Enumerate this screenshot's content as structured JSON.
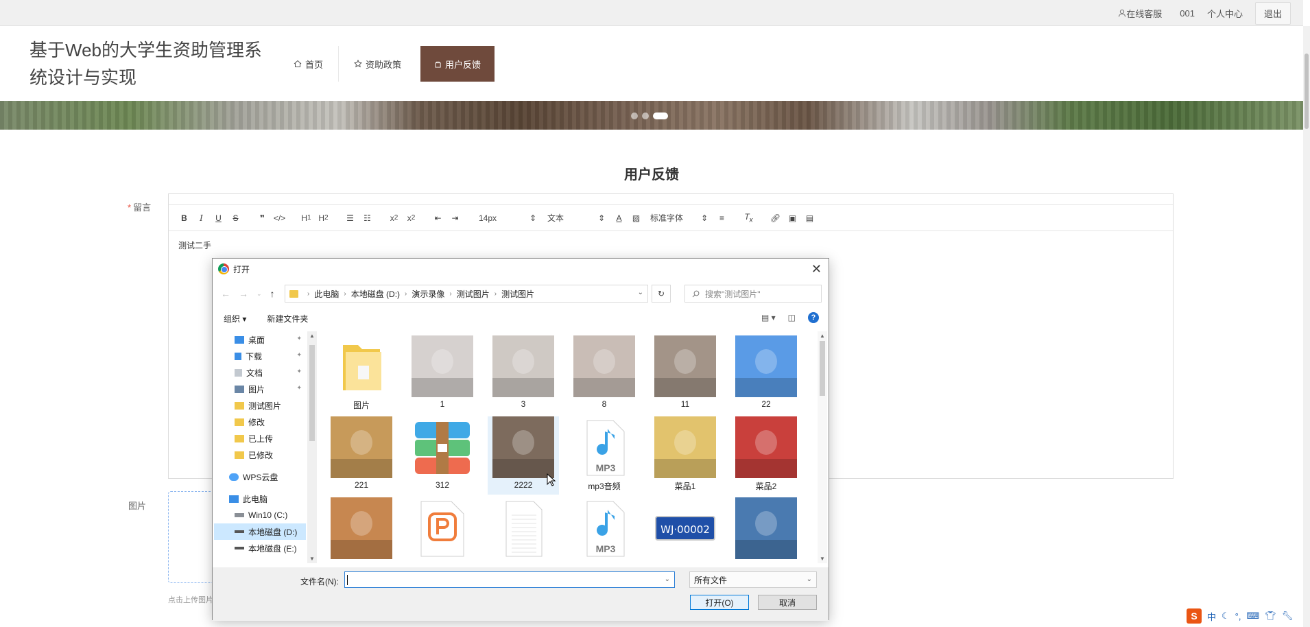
{
  "topbar": {
    "service": "在线客服",
    "user": "001",
    "center": "个人中心",
    "logout": "退出"
  },
  "header": {
    "brand": "基于Web的大学生资助管理系统设计与实现"
  },
  "nav": [
    {
      "label": "首页"
    },
    {
      "label": "资助政策"
    },
    {
      "label": "用户反馈"
    }
  ],
  "page": {
    "title": "用户反馈"
  },
  "form": {
    "message_label": "留言",
    "required_mark": "*",
    "image_label": "图片",
    "upload_tip": "点击上传图片"
  },
  "editor": {
    "font_size": "14px",
    "block": "文本",
    "font_family": "标准字体",
    "content": "测试二手"
  },
  "dialog": {
    "title": "打开",
    "path": [
      "此电脑",
      "本地磁盘 (D:)",
      "演示录像",
      "测试图片",
      "测试图片"
    ],
    "search_placeholder": "搜索\"测试图片\"",
    "organize": "组织",
    "new_folder": "新建文件夹",
    "sidebar": [
      {
        "label": "桌面",
        "color": "#3a8ee6",
        "pinned": true
      },
      {
        "label": "下载",
        "color": "#3a8ee6",
        "pinned": true
      },
      {
        "label": "文档",
        "color": "#9aa3ad",
        "pinned": true
      },
      {
        "label": "图片",
        "color": "#6a86a6",
        "pinned": true
      },
      {
        "label": "测试图片",
        "color": "#f1c84b",
        "pinned": false
      },
      {
        "label": "修改",
        "color": "#f1c84b",
        "pinned": false
      },
      {
        "label": "已上传",
        "color": "#f1c84b",
        "pinned": false
      },
      {
        "label": "已修改",
        "color": "#f1c84b",
        "pinned": false
      }
    ],
    "sidebar_groups": [
      {
        "label": "WPS云盘",
        "color": "#4fa3f7"
      },
      {
        "label": "此电脑",
        "color": "#3a8ee6"
      }
    ],
    "drives": [
      {
        "label": "Win10 (C:)",
        "selected": false
      },
      {
        "label": "本地磁盘 (D:)",
        "selected": true
      },
      {
        "label": "本地磁盘 (E:)",
        "selected": false
      }
    ],
    "files": [
      {
        "name": "图片",
        "kind": "folder"
      },
      {
        "name": "1",
        "kind": "photo",
        "color": "#d6d1cf"
      },
      {
        "name": "3",
        "kind": "photo",
        "color": "#cfc9c4"
      },
      {
        "name": "8",
        "kind": "photo",
        "color": "#c9bdb6"
      },
      {
        "name": "11",
        "kind": "photo",
        "color": "#a39488"
      },
      {
        "name": "22",
        "kind": "photo",
        "color": "#5a9be6"
      },
      {
        "name": "221",
        "kind": "photo",
        "color": "#c79a5a"
      },
      {
        "name": "312",
        "kind": "archive"
      },
      {
        "name": "2222",
        "kind": "photo",
        "color": "#7d6b5d",
        "selected": true
      },
      {
        "name": "mp3音频",
        "kind": "mp3"
      },
      {
        "name": "菜品1",
        "kind": "photo",
        "color": "#e2c36d"
      },
      {
        "name": "菜品2",
        "kind": "photo",
        "color": "#c9403c"
      },
      {
        "name": "",
        "kind": "photo",
        "color": "#c78750"
      },
      {
        "name": "",
        "kind": "ppt"
      },
      {
        "name": "",
        "kind": "doc"
      },
      {
        "name": "",
        "kind": "mp3"
      },
      {
        "name": "",
        "kind": "plate",
        "text": "WJ·00002"
      },
      {
        "name": "",
        "kind": "photo",
        "color": "#4a7ab0"
      }
    ],
    "filename_label": "文件名(N):",
    "filename_value": "",
    "filetype": "所有文件",
    "open_button": "打开(O)",
    "cancel_button": "取消"
  },
  "tray": {
    "ime": "中"
  }
}
